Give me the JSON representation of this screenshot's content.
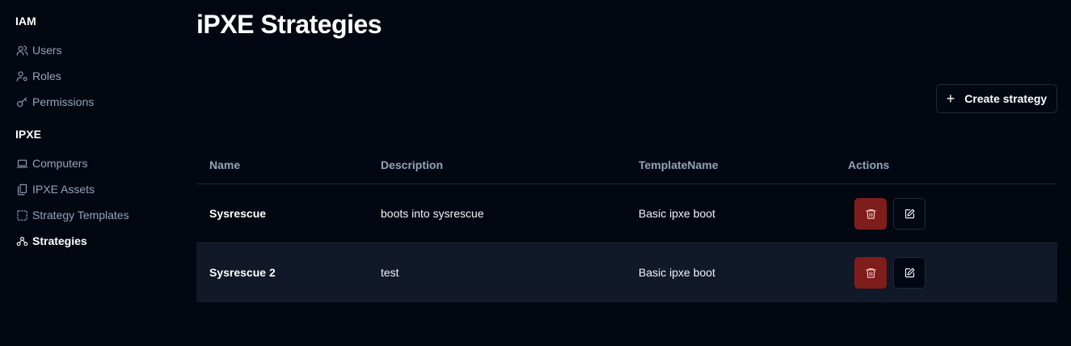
{
  "sidebar": {
    "sections": [
      {
        "title": "IAM",
        "items": [
          {
            "label": "Users",
            "icon": "users-icon"
          },
          {
            "label": "Roles",
            "icon": "user-cog-icon"
          },
          {
            "label": "Permissions",
            "icon": "key-icon"
          }
        ]
      },
      {
        "title": "IPXE",
        "items": [
          {
            "label": "Computers",
            "icon": "laptop-icon"
          },
          {
            "label": "IPXE Assets",
            "icon": "files-icon"
          },
          {
            "label": "Strategy Templates",
            "icon": "dashed-square-icon"
          },
          {
            "label": "Strategies",
            "icon": "workflow-icon",
            "active": true
          }
        ]
      }
    ]
  },
  "main": {
    "title": "iPXE Strategies",
    "create_button_label": "Create strategy",
    "table": {
      "columns": [
        "Name",
        "Description",
        "TemplateName",
        "Actions"
      ],
      "rows": [
        {
          "name": "Sysrescue",
          "description": "boots into sysrescue",
          "template": "Basic ipxe boot"
        },
        {
          "name": "Sysrescue 2",
          "description": "test",
          "template": "Basic ipxe boot"
        }
      ]
    }
  },
  "colors": {
    "background": "#030712",
    "delete_button": "#7f1d1d",
    "row_alt": "#111827",
    "border": "#1f2937"
  }
}
